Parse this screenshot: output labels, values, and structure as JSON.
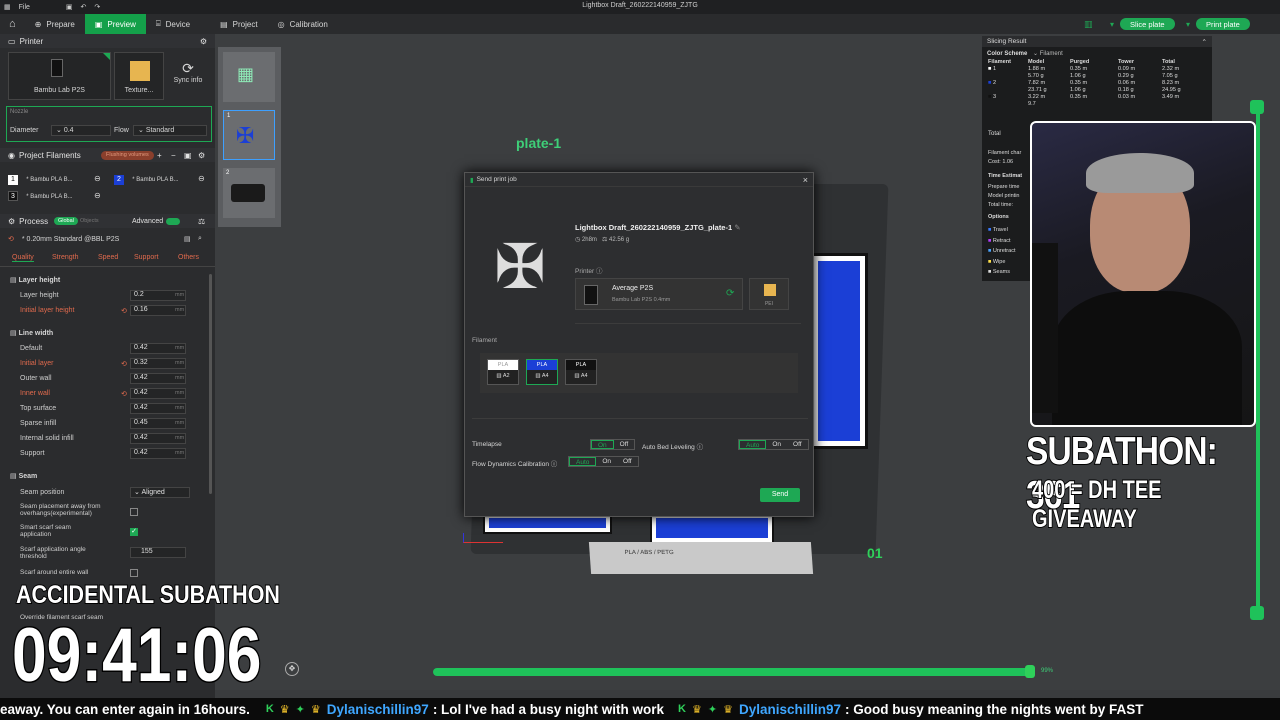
{
  "window": {
    "title": "Lightbox Draft_260222140959_ZJTG",
    "file_menu": "File"
  },
  "tabs": [
    {
      "label": "Prepare"
    },
    {
      "label": "Preview",
      "active": true
    },
    {
      "label": "Device"
    },
    {
      "label": "Project"
    },
    {
      "label": "Calibration"
    }
  ],
  "toolbar": {
    "slice_label": "Slice plate",
    "print_label": "Print plate"
  },
  "left": {
    "printer_header": "Printer",
    "printer_name": "Bambu Lab P2S",
    "texture_label": "Texture...",
    "sync_label": "Sync info",
    "nozzle_label": "Nozzle",
    "diameter_label": "Diameter",
    "diameter_value": "0.4",
    "flow_label": "Flow",
    "flow_value": "Standard",
    "filaments_header": "Project Filaments",
    "filaments_badge": "Flushing volumes",
    "filaments": [
      {
        "num": "1",
        "name": "* Bambu PLA B...",
        "color": "#ffffff"
      },
      {
        "num": "2",
        "name": "* Bambu PLA B...",
        "color": "#1b3fd6"
      },
      {
        "num": "3",
        "name": "* Bambu PLA B...",
        "color": "#111111"
      }
    ],
    "process_header": "Process",
    "process_global": "Global",
    "process_objects": "Objects",
    "advanced_label": "Advanced",
    "process_preset": "* 0.20mm Standard @BBL P2S",
    "quality_tabs": [
      "Quality",
      "Strength",
      "Speed",
      "Support",
      "Others"
    ],
    "layer_height_header": "Layer height",
    "layer_height": [
      {
        "label": "Layer height",
        "value": "0.2",
        "unit": "mm"
      },
      {
        "label": "Initial layer height",
        "value": "0.16",
        "unit": "mm"
      }
    ],
    "line_width_header": "Line width",
    "line_width": [
      {
        "label": "Default",
        "value": "0.42",
        "unit": "mm"
      },
      {
        "label": "Initial layer",
        "value": "0.32",
        "unit": "mm"
      },
      {
        "label": "Outer wall",
        "value": "0.42",
        "unit": "mm"
      },
      {
        "label": "Inner wall",
        "value": "0.42",
        "unit": "mm"
      },
      {
        "label": "Top surface",
        "value": "0.42",
        "unit": "mm"
      },
      {
        "label": "Sparse infill",
        "value": "0.45",
        "unit": "mm"
      },
      {
        "label": "Internal solid infill",
        "value": "0.42",
        "unit": "mm"
      },
      {
        "label": "Support",
        "value": "0.42",
        "unit": "mm"
      }
    ],
    "seam_header": "Seam",
    "seam_position_label": "Seam position",
    "seam_position_value": "Aligned",
    "seam_away_label": "Seam placement away from overhangs(experimental)",
    "smart_scarf_label": "Smart scarf seam application",
    "scarf_angle_label": "Scarf application angle threshold",
    "scarf_angle_value": "155",
    "scarf_around_label": "Scarf around entire wall",
    "override_label": "Override filament scarf seam"
  },
  "plates": [
    {
      "num": "1"
    },
    {
      "num": "2"
    }
  ],
  "viewport": {
    "plate_label": "plate-1",
    "plate_corner": "01",
    "bed_text": "PLA / ABS / PETG",
    "progress_pct": "99%"
  },
  "dialog": {
    "title": "Send print job",
    "job_name": "Lightbox Draft_260222140959_ZJTG_plate-1",
    "time": "2h8m",
    "weight": "42.56 g",
    "printer_label": "Printer",
    "printer_name": "Average P2S",
    "printer_sub": "Bambu Lab P2S 0.4mm",
    "plate_type": "PEI",
    "filament_label": "Filament",
    "filaments": [
      {
        "type": "PLA",
        "slot": "A2",
        "color": "#ffffff"
      },
      {
        "type": "PLA",
        "slot": "A4",
        "color": "#1b3fd6"
      },
      {
        "type": "PLA",
        "slot": "A4",
        "color": "#111111"
      }
    ],
    "timelapse_label": "Timelapse",
    "bed_leveling_label": "Auto Bed Leveling",
    "flow_cal_label": "Flow Dynamics Calibration",
    "opt_on": "On",
    "opt_off": "Off",
    "opt_auto": "Auto",
    "send_label": "Send"
  },
  "slicing": {
    "title": "Slicing Result",
    "scheme_label": "Color Scheme",
    "scheme_value": "Filament",
    "headers": [
      "Filament",
      "Model",
      "Purged",
      "Tower",
      "Total"
    ],
    "rows": [
      {
        "num": "1",
        "model": "1.88 m\n5.70 g",
        "purged": "0.35 m\n1.06 g",
        "tower": "0.09 m\n0.29 g",
        "total": "2.32 m\n7.05 g"
      },
      {
        "num": "2",
        "model": "7.82 m\n23.71 g",
        "purged": "0.35 m\n1.06 g",
        "tower": "0.06 m\n0.18 g",
        "total": "8.23 m\n24.95 g"
      },
      {
        "num": "3",
        "model": "3.22 m\n9.7",
        "purged": "0.35 m",
        "tower": "0.03 m",
        "total": "3.49 m"
      }
    ],
    "total_label": "Total",
    "filament_change_label": "Filament char",
    "cost_label": "Cost: 1.06",
    "time_label": "Time Estimat",
    "prepare_label": "Prepare time",
    "model_label": "Model printin",
    "total_time_label": "Total time:",
    "options_label": "Options",
    "options": [
      "Travel",
      "Retract",
      "Unretract",
      "Wipe",
      "Seams"
    ]
  },
  "overlay": {
    "subathon_count": "SUBATHON: 361",
    "giveaway": "400 = DH TEE GIVEAWAY",
    "accidental": "ACCIDENTAL SUBATHON",
    "timer": "09:41:06"
  },
  "ticker": {
    "text1": "eaway. You can enter again in 16hours.",
    "user1": "Dylanischillin97",
    "msg1": ": Lol I've had a busy night with work",
    "user2": "Dylanischillin97",
    "msg2": ": Good busy meaning the nights went by FAST"
  },
  "colors": {
    "accent": "#1ea854",
    "blue": "#1b3fd6",
    "panel": "#2b2c2e"
  }
}
